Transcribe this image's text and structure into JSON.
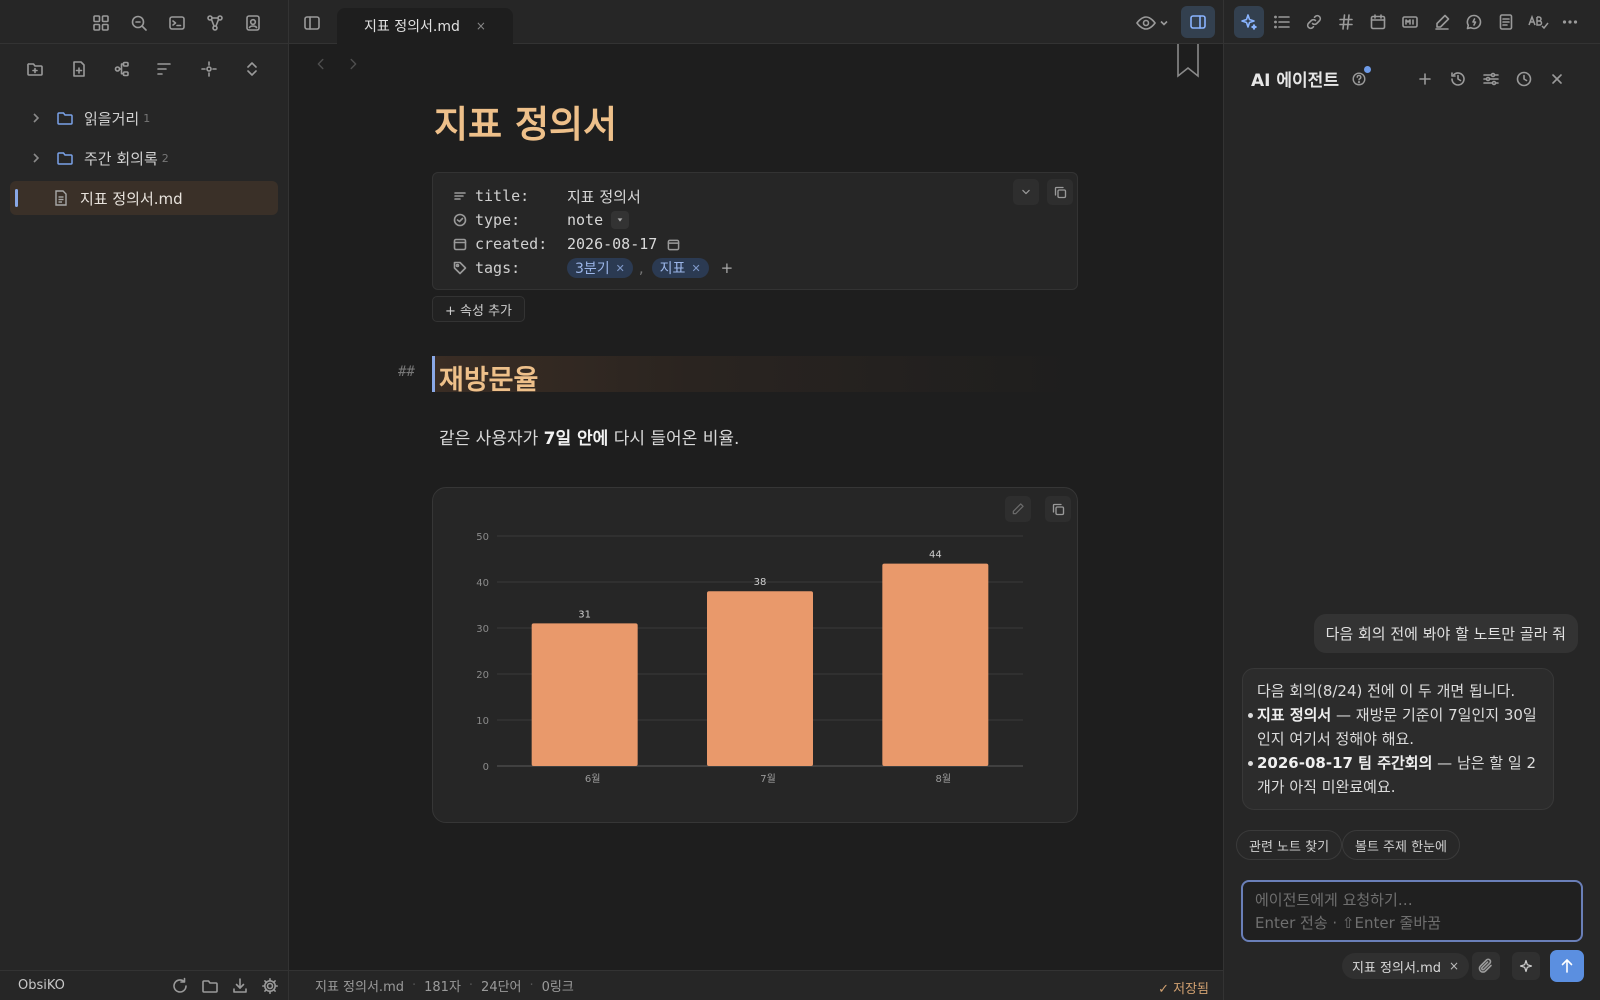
{
  "sidebar": {
    "tree": [
      {
        "label": "읽을거리",
        "count": "1",
        "type": "folder"
      },
      {
        "label": "주간 회의록",
        "count": "2",
        "type": "folder"
      },
      {
        "label": "지표 정의서.md",
        "type": "file",
        "active": true
      }
    ],
    "vault_name": "ObsiKO"
  },
  "tab": {
    "title": "지표 정의서.md",
    "close": "×"
  },
  "doc": {
    "title": "지표 정의서",
    "properties": [
      {
        "key": "title:",
        "value": "지표 정의서"
      },
      {
        "key": "type:",
        "value": "note"
      },
      {
        "key": "created:",
        "value": "2026-08-17"
      },
      {
        "key": "tags:",
        "tags": [
          "3분기",
          "지표"
        ]
      }
    ],
    "tag_sep": ",",
    "tag_add": "+",
    "add_property": "+ 속성 추가",
    "h2_mark": "##",
    "heading": "재방문율",
    "para_before": "같은 사용자가 ",
    "para_bold": "7일 안에",
    "para_after": " 다시 들어온 비율."
  },
  "chart_data": {
    "type": "bar",
    "categories": [
      "6월",
      "7월",
      "8월"
    ],
    "values": [
      31,
      38,
      44
    ],
    "ylim": [
      0,
      50
    ],
    "yticks": [
      0,
      10,
      20,
      30,
      40,
      50
    ],
    "grid": true,
    "bar_color": "#e9996b"
  },
  "status": {
    "file": "지표 정의서.md",
    "chars": "181자",
    "words": "24단어",
    "links": "0링크",
    "saved": "✓ 저장됨",
    "sep": "·"
  },
  "ai": {
    "title": "AI 에이전트",
    "user_message": "다음 회의 전에 봐야 할 노트만 골라 줘",
    "reply_intro": "다음 회의(8/24) 전에 이 두 개면 됩니다.",
    "reply_items": [
      {
        "bold": "지표 정의서",
        "text": " — 재방문 기준이 7일인지 30일인지 여기서 정해야 해요."
      },
      {
        "bold": "2026-08-17 팀 주간회의",
        "text": " — 남은 할 일 2개가 아직 미완료예요."
      }
    ],
    "chips": [
      "관련 노트 찾기",
      "볼트 주제 한눈에"
    ],
    "composer_placeholder": "에이전트에게 요청하기…",
    "composer_hint": "Enter 전송 · ⇧Enter 줄바꿈",
    "context_file": "지표 정의서.md",
    "context_close": "×"
  },
  "colors": {
    "accent": "#8aa8e6",
    "heading": "#eec08a",
    "bar": "#e9996b",
    "tag_bg": "#2b3a52",
    "send": "#5b8fe0"
  }
}
